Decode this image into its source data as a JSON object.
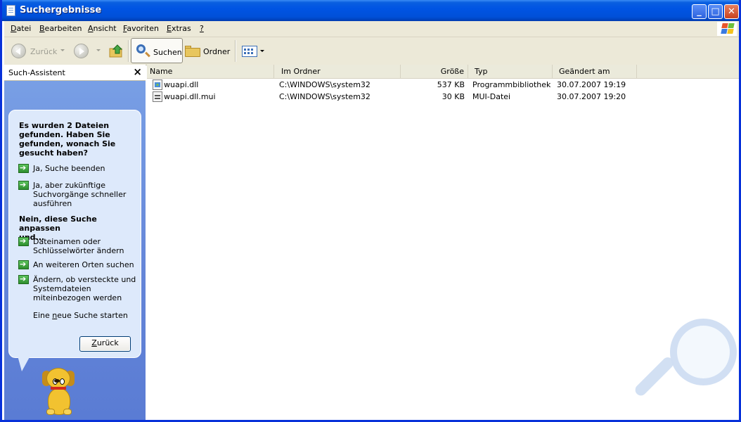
{
  "window": {
    "title": "Suchergebnisse"
  },
  "menu": [
    {
      "pre": "",
      "ul": "D",
      "post": "atei"
    },
    {
      "pre": "",
      "ul": "B",
      "post": "earbeiten"
    },
    {
      "pre": "",
      "ul": "A",
      "post": "nsicht"
    },
    {
      "pre": "",
      "ul": "F",
      "post": "avoriten"
    },
    {
      "pre": "",
      "ul": "E",
      "post": "xtras"
    },
    {
      "pre": "",
      "ul": "?",
      "post": ""
    }
  ],
  "toolbar": {
    "back_label": "Zurück",
    "search_label": "Suchen",
    "folders_label": "Ordner"
  },
  "search_pane": {
    "title": "Such-Assistent",
    "close_glyph": "×",
    "question": [
      "Es wurden 2 Dateien",
      "gefunden. Haben Sie",
      "gefunden, wonach Sie",
      "gesucht haben?"
    ],
    "yes_options": [
      [
        "Ja, Suche beenden"
      ],
      [
        "Ja, aber zukünftige",
        "Suchvorgänge schneller",
        "ausführen"
      ]
    ],
    "no_heading": [
      "Nein, diese Suche anpassen",
      "und..."
    ],
    "no_options": [
      [
        "Dateinamen oder",
        "Schlüsselwörter ändern"
      ],
      [
        "An weiteren Orten suchen"
      ],
      [
        "Ändern, ob versteckte und",
        "Systemdateien",
        "miteinbezogen werden"
      ]
    ],
    "new_search": {
      "pre": "Eine ",
      "ul": "n",
      "post": "eue Suche starten"
    },
    "back_button": {
      "ul": "Z",
      "post": "urück"
    }
  },
  "columns": [
    "Name",
    "Im Ordner",
    "Größe",
    "Typ",
    "Geändert am"
  ],
  "files": [
    {
      "name": "wuapi.dll",
      "folder": "C:\\WINDOWS\\system32",
      "size": "537 KB",
      "type": "Programmbibliothek",
      "modified": "30.07.2007 19:19",
      "icon": "dll-file-icon"
    },
    {
      "name": "wuapi.dll.mui",
      "folder": "C:\\WINDOWS\\system32",
      "size": "30 KB",
      "type": "MUI-Datei",
      "modified": "30.07.2007 19:20",
      "icon": "mui-file-icon"
    }
  ],
  "colors": {
    "titlebar": "#0054e3",
    "chrome": "#ece9d8",
    "pane": "#6485d8",
    "bubble": "#dde9fb"
  }
}
